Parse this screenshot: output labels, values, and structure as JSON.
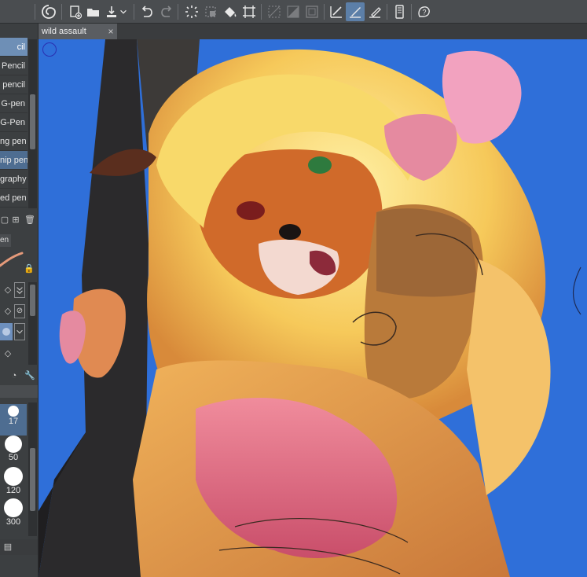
{
  "document": {
    "tab_title": "wild assault",
    "close_glyph": "×"
  },
  "toolbar": {
    "icons": [
      "clip-studio-icon",
      "new-canvas-icon",
      "open-file-icon",
      "save-icon",
      "undo-icon",
      "redo-icon",
      "loading-icon",
      "transform-icon",
      "fill-icon",
      "selection-icon",
      "clear-icon",
      "invert-icon",
      "border-icon",
      "line-tool-icon",
      "pen-tool-active-icon",
      "eraser-tool-icon",
      "device-icon",
      "help-icon"
    ]
  },
  "brush_list": {
    "items": [
      {
        "label": "cil",
        "state": "selected-top"
      },
      {
        "label": "Pencil",
        "state": ""
      },
      {
        "label": "pencil",
        "state": ""
      },
      {
        "label": "G-pen",
        "state": ""
      },
      {
        "label": "G-Pen",
        "state": ""
      },
      {
        "label": "ng pen",
        "state": ""
      },
      {
        "label": "nip pen",
        "state": "selected"
      },
      {
        "label": "graphy",
        "state": ""
      },
      {
        "label": "ed pen",
        "state": ""
      }
    ]
  },
  "tool_property": {
    "tab_label": "en"
  },
  "brush_sizes": {
    "items": [
      {
        "label": "17"
      },
      {
        "label": "50"
      },
      {
        "label": "120"
      },
      {
        "label": "300"
      }
    ]
  },
  "colors": {
    "sky": "#2f6fd9",
    "accent": "#5c7fa8",
    "panel": "#3c3f41"
  }
}
